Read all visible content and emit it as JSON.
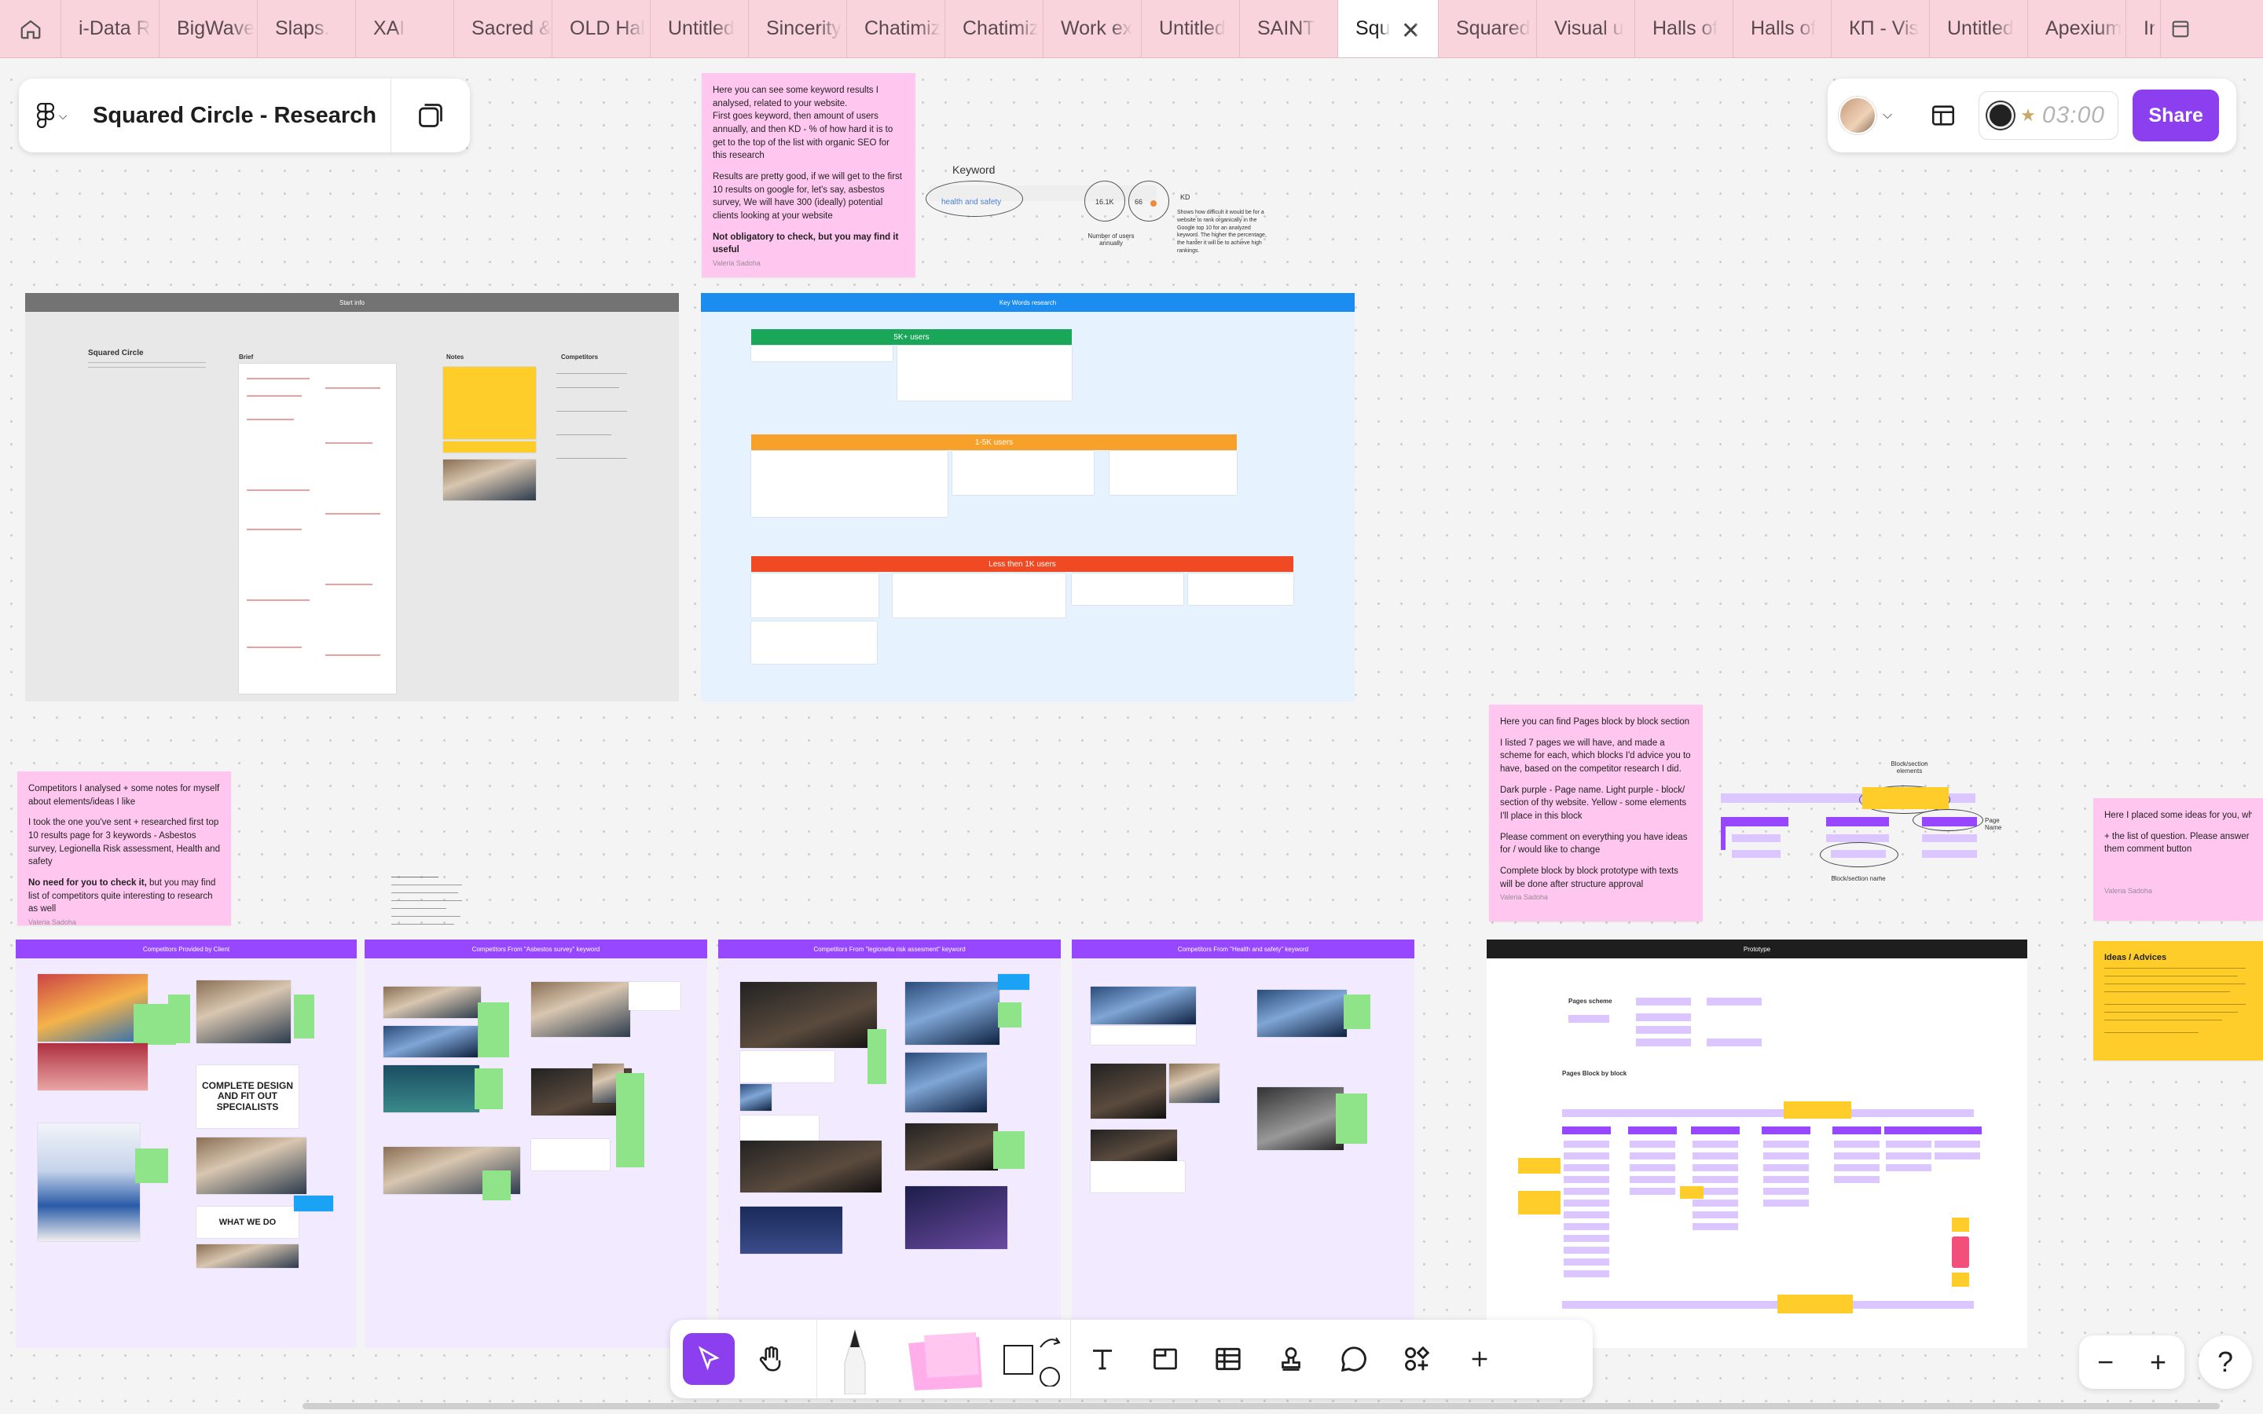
{
  "tabs": [
    "i-Data R",
    "BigWave",
    "Slaps.",
    "XAI",
    "Sacred &",
    "OLD Hal",
    "Untitled",
    "Sincerity",
    "Chatimiz",
    "Chatimiz",
    "Work ex",
    "Untitled",
    "SAINT",
    "Squ",
    "Squared",
    "Visual u",
    "Halls of",
    "Halls of",
    "КП - Vis",
    "Untitled",
    "Apexium",
    "Ir"
  ],
  "active_tab_index": 13,
  "file": {
    "title": "Squared Circle - Research"
  },
  "topbar": {
    "timer": "03:00",
    "share_label": "Share"
  },
  "sticky_keywords": {
    "p1": "Here you can see some keyword results I analysed, related to your website.",
    "p2": "First goes keyword, then amount of users annually, and then KD - % of how hard it is to get to the top of the list with organic SEO for this research",
    "p3": "Results are pretty good, if we will get to the first 10 results on google for, let's say, asbestos survey, We will have 300 (ideally) potential clients looking at your website",
    "p4": "Not obligatory to check, but you may find it useful",
    "sig": "Valeria Sadoha"
  },
  "keyword_legend": {
    "title": "Keyword",
    "example": "health and safety",
    "users": "16.1K",
    "kd": "66",
    "kd_label": "KD",
    "users_label": "Number of users annually",
    "kd_desc": "Shows how difficult it would be for a website to rank organically in the Google top 10 for an analyzed keyword. The higher the percentage, the harder it will be to achieve high rankings."
  },
  "frames": {
    "start_info": {
      "title": "Start info",
      "heading": "Squared Circle",
      "brief": "Brief",
      "notes": "Notes",
      "competitors": "Competitors"
    },
    "keywords": {
      "title": "Key Words research",
      "band1": "5K+ users",
      "band2": "1-5K users",
      "band3": "Less then 1K users"
    },
    "comp_client": {
      "title": "Competitors Provided by Client"
    },
    "comp_asbestos": {
      "title": "Competitors From \"Asbestos survey\" keyword"
    },
    "comp_legionella": {
      "title": "Competitors From \"legionella risk assesment\" keyword"
    },
    "comp_health": {
      "title": "Competitors From \"Health and safety\" keyword"
    },
    "prototype": {
      "title": "Prototype",
      "pages_scheme": "Pages scheme",
      "pages_block": "Pages Block by block"
    }
  },
  "poster_text": {
    "complete": "COMPLETE DESIGN AND FIT OUT SPECIALISTS",
    "what_we_do": "WHAT WE DO"
  },
  "sticky_competitors": {
    "p1": "Competitors I analysed + some notes for myself about elements/ideas I like",
    "p2": "I took the one you've sent + researched first top 10 results page for 3 keywords - Asbestos survey, Legionella Risk assessment, Health and safety",
    "p3_bold": "No need for you to check it,",
    "p3": " but you may find list of competitors quite interesting to research as well",
    "sig": "Valeria Sadoha"
  },
  "sticky_pages": {
    "p1": "Here you can find Pages block by block section",
    "p2": "I listed 7 pages we will have, and made a scheme for each, which blocks I'd advice you to have, based on the competitor research I did.",
    "p3": "Dark purple - Page name. Light purple - block/ section of thy website. Yellow - some elements I'll place in this block",
    "p4": "Please comment on everything you have ideas for / would like to change",
    "p5": "Complete block by block prototype with texts will be done after structure approval",
    "sig": "Valeria Sadoha"
  },
  "legend_diagram": {
    "block_elements": "Block/section elements",
    "page_name": "Page Name",
    "block_name": "Block/section name"
  },
  "sticky_ideas": {
    "p1": "Here I placed some ideas for you, which n",
    "p2": "+ the list of question. Please answer them comment button",
    "sig": "Valeria Sadoha"
  },
  "ideas_card": {
    "title": "Ideas / Advices"
  },
  "colors": {
    "accent": "#8b3fee",
    "tabbar": "#f9d4dc",
    "sticky_pink": "#ffc6f0",
    "sticky_yellow": "#ffcd29",
    "green_band": "#1aa75a",
    "orange_band": "#f7a02a",
    "red_band": "#f04a24",
    "blue_header": "#1b8cf0"
  },
  "icons": [
    "home-icon",
    "figma-logo-icon",
    "pages-icon",
    "layout-icon",
    "timer-icon",
    "move-icon",
    "hand-icon",
    "pen-icon",
    "sticky-note-icon",
    "rectangle-icon",
    "connector-icon",
    "text-icon",
    "section-icon",
    "table-icon",
    "stamp-icon",
    "comment-icon",
    "widgets-icon",
    "plus-icon",
    "zoom-out-icon",
    "zoom-in-icon",
    "help-icon"
  ]
}
